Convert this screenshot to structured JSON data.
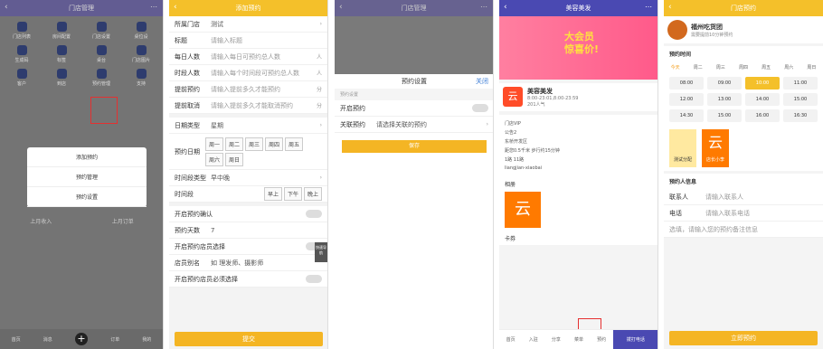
{
  "p1": {
    "title": "门店管理",
    "grid": [
      "门店列表",
      "房间配置",
      "门店设置",
      "桌位设",
      "生成码",
      "标签",
      "桌台",
      "门店图片",
      "客户",
      "到店",
      "预约管理",
      "支持",
      "我的"
    ],
    "menu": [
      "添加预约",
      "预约管理",
      "预约设置"
    ],
    "mid": [
      "上月收入",
      "上月订单",
      "上月收入",
      "上月订单"
    ],
    "tabs": [
      "首页",
      "消息",
      "发布",
      "订单",
      "我的"
    ]
  },
  "p2": {
    "title": "添加预约",
    "rows": [
      {
        "l": "所属门店",
        "v": "测试"
      },
      {
        "l": "标题",
        "v": "请输入标题"
      },
      {
        "l": "每日人数",
        "v": "请输入每日可预约总人数",
        "r": "人"
      },
      {
        "l": "时段人数",
        "v": "请输入每个时间段可预约总人数",
        "r": "人"
      },
      {
        "l": "提前预约",
        "v": "请输入提前多久才能预约",
        "r": "分"
      },
      {
        "l": "提前取消",
        "v": "请输入提前多久才能取消预约",
        "r": "分"
      }
    ],
    "daytype_l": "日期类型",
    "daytype_v": "星期",
    "weekday_l": "预约日期",
    "days": [
      "周一",
      "周二",
      "周三",
      "周四",
      "周五",
      "周六",
      "周日"
    ],
    "tt_l": "时间段类型",
    "tt_v": "早中晚",
    "slot_l": "时间段",
    "slots": [
      "早上",
      "下午",
      "晚上"
    ],
    "confirm": "开启预约确认",
    "days_l": "预约天数",
    "days_v": "7",
    "staff": "开启预约店员选择",
    "alias_l": "店员别名",
    "alias_v": "如 理发师、摄影师",
    "must": "开启预约店员必须选择",
    "submit": "提交",
    "quick": "快速导航"
  },
  "p3": {
    "title": "门店管理",
    "sheet_title": "预约设置",
    "close": "关闭",
    "lbl": "预约设置",
    "open": "开启预约",
    "rel_l": "关联预约",
    "rel_v": "请选择关联的预约",
    "save": "保存"
  },
  "p4": {
    "title": "美容美发",
    "banner1": "大会员",
    "banner2": "惊喜价!",
    "shop": "美容美发",
    "hours": "8:00-23:01,8:00-23:59",
    "pop": "201人气",
    "vip": "门店VIP",
    "coupon": "公告2",
    "addr": "东桥开发区",
    "dist": "距您0.5千米 步行约15分钟",
    "tel": "1路 11路",
    "wx": "liangjian-xiaobai",
    "album": "相册",
    "card": "卡券",
    "tabs": [
      "首页",
      "入驻",
      "分享",
      "菜单",
      "预约"
    ],
    "call": "拨打电话"
  },
  "p5": {
    "title": "门店预约",
    "shop": "福州吃货团",
    "wait": "需要提前10分钟预约",
    "sec1": "预约时间",
    "days": [
      "今天",
      "周二",
      "周三",
      "周四",
      "周五",
      "周六",
      "周日"
    ],
    "times": [
      "08:00",
      "09:00",
      "10:00",
      "11:00",
      "12:00",
      "13:00",
      "14:00",
      "15:00",
      "14:30",
      "15:00",
      "16:00",
      "16:30"
    ],
    "staff": [
      "测试分配",
      "店长小李"
    ],
    "sec2": "预约人信息",
    "name_l": "联系人",
    "name_v": "请输入联系人",
    "tel_l": "电话",
    "tel_v": "请输入联系电话",
    "note": "选填，请输入您的预约备注信息",
    "book": "立即预约"
  }
}
